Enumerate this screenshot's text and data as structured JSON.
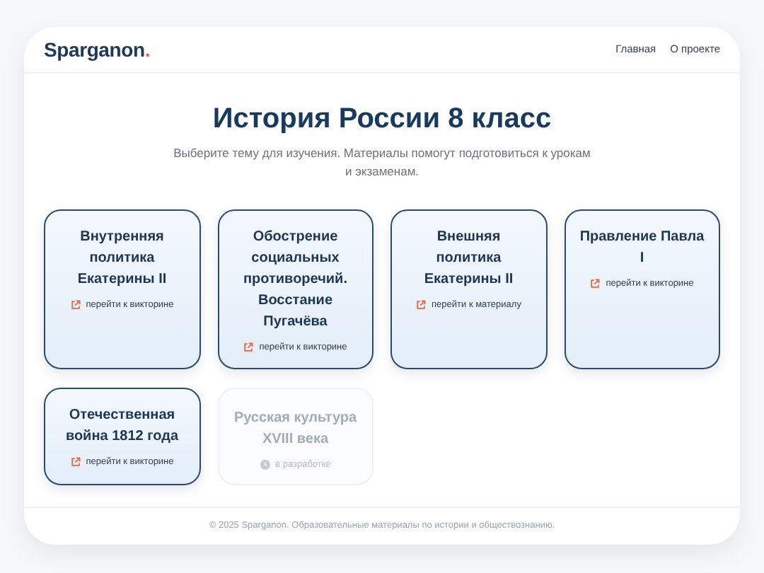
{
  "header": {
    "logo": "Sparganon",
    "logo_dot": ".",
    "nav": [
      {
        "label": "Главная"
      },
      {
        "label": "О проекте"
      }
    ]
  },
  "title": "История России 8 класс",
  "subtitle": "Выберите тему для изучения. Материалы помогут подготовиться к урокам и экзаменам.",
  "cards": [
    {
      "title": "Внутренняя политика Екатерины II",
      "link": "перейти к викторине",
      "disabled": false
    },
    {
      "title": "Обострение социальных противоречий. Восстание Пугачёва",
      "link": "перейти к викторине",
      "disabled": false
    },
    {
      "title": "Внешняя политика Екатерины II",
      "link": "перейти к материалу",
      "disabled": false
    },
    {
      "title": "Правление Павла I",
      "link": "перейти к викторине",
      "disabled": false
    },
    {
      "title": "Отечественная война 1812 года",
      "link": "перейти к викторине",
      "disabled": false
    },
    {
      "title": "Русская культура XVIII века",
      "link": "в разработке",
      "disabled": true
    }
  ],
  "footer": "© 2025 Sparganon. Образовательные материалы по истории и обществознанию."
}
